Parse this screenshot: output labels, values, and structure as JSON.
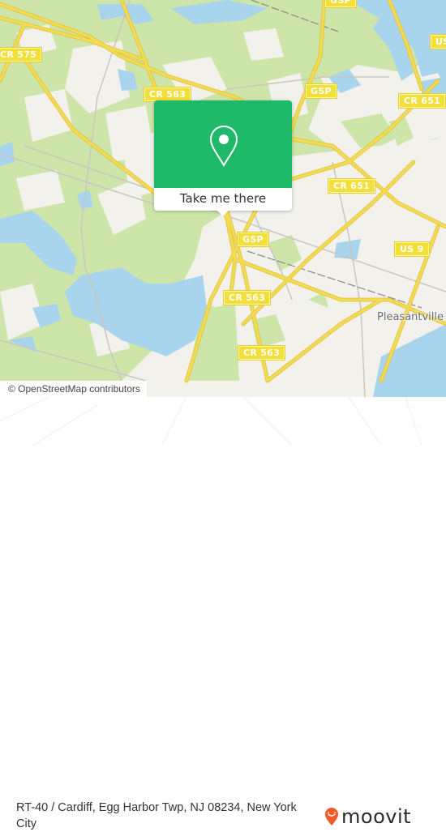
{
  "map": {
    "colors": {
      "land": "#f2f1ec",
      "forest": "#cde5a9",
      "water": "#a8d4ee",
      "road": "#f3dc55",
      "road_edge": "#e3c640",
      "minor_road": "#c9c6bf",
      "rail": "#888888"
    },
    "road_labels": [
      {
        "id": "cr575",
        "text": "CR 575"
      },
      {
        "id": "cr563-north",
        "text": "CR 563"
      },
      {
        "id": "gsp-north",
        "text": "GSP"
      },
      {
        "id": "gsp-top",
        "text": "GSP"
      },
      {
        "id": "us-top",
        "text": "US"
      },
      {
        "id": "cr651-east",
        "text": "CR 651"
      },
      {
        "id": "cr651-mid",
        "text": "CR 651"
      },
      {
        "id": "gsp-center",
        "text": "GSP"
      },
      {
        "id": "us9",
        "text": "US 9"
      },
      {
        "id": "cr563-center",
        "text": "CR 563"
      },
      {
        "id": "cr563-south",
        "text": "CR 563"
      }
    ],
    "place_labels": [
      {
        "id": "pleasantville",
        "text": "Pleasantville"
      }
    ],
    "attribution": "© OpenStreetMap contributors"
  },
  "popup": {
    "icon": "location-pin-icon",
    "accent": "#1fb96a",
    "button_label": "Take me there"
  },
  "footer": {
    "address": "RT-40 / Cardiff, Egg Harbor Twp, NJ 08234, New York City",
    "brand": {
      "name": "moovit",
      "icon": "moovit-pin-smile-icon",
      "color": "#f15a2b"
    }
  }
}
